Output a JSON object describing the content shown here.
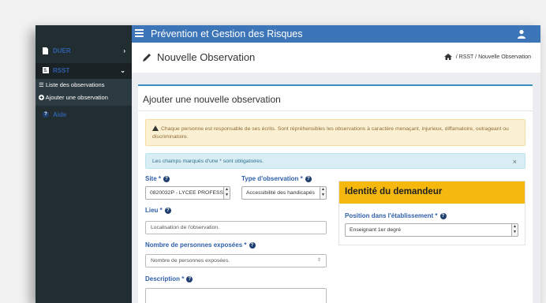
{
  "app": {
    "title": "Prévention et Gestion des Risques"
  },
  "sidebar": {
    "duer": "DUER",
    "rsst": "RSST",
    "sub_items": [
      "Liste des observations",
      "Ajouter une observation"
    ],
    "aide": "Aide"
  },
  "header": {
    "title": "Nouvelle Observation",
    "breadcrumb": {
      "sep": "/",
      "rsst": "RSST",
      "current": "Nouvelle Observation"
    }
  },
  "card": {
    "title": "Ajouter une nouvelle observation",
    "warning": "Chaque personne est responsable de ses écrits. Sont répréhensibles les observations à caractère menaçant, injurieux, diffamatoire, outrageant ou discriminatoire.",
    "info": "Les champs marqués d'une * sont obligatoires.",
    "close": "×"
  },
  "form": {
    "site": {
      "label": "Site *",
      "value": "0820032P - LYCEE PROFESS"
    },
    "type": {
      "label": "Type d'observation *",
      "value": "Accessibilité des handicapés"
    },
    "lieu": {
      "label": "Lieu *",
      "placeholder": "Localisation de l'observation."
    },
    "nb": {
      "label": "Nombre de personnes exposées *",
      "placeholder": "Nombre de personnes exposées."
    },
    "description": {
      "label": "Description *"
    }
  },
  "identity": {
    "title": "Identité du demandeur",
    "position_label": "Position dans l'établissement *",
    "position_value": "Enseignant 1er degré"
  },
  "colors": {
    "topbar": "#3c75b8",
    "sidebar": "#222d32",
    "identity_header": "#f5b80f",
    "label": "#2f5fa8"
  }
}
